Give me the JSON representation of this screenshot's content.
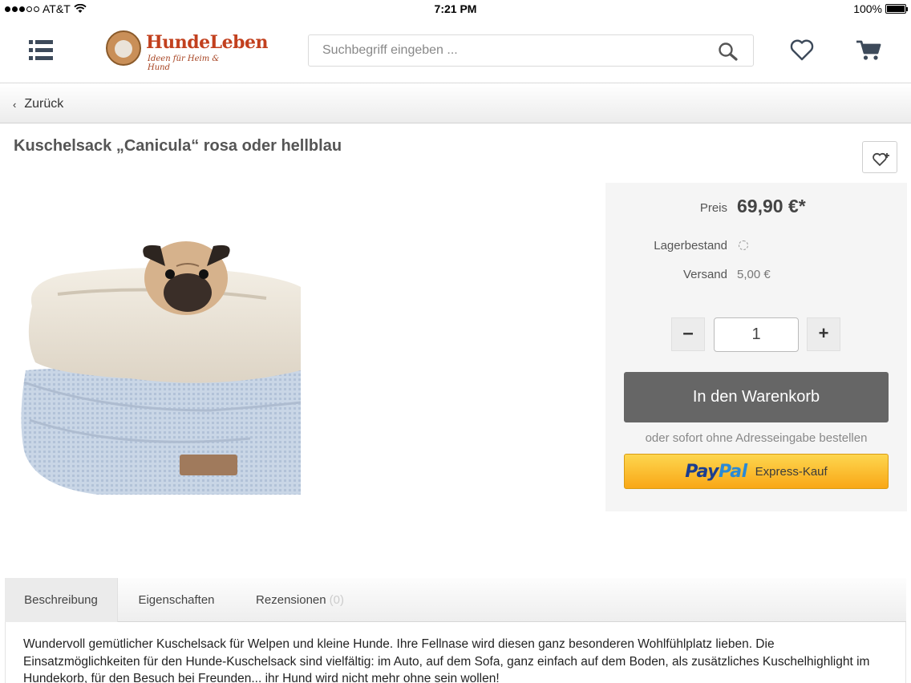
{
  "status_bar": {
    "carrier": "AT&T",
    "time": "7:21 PM",
    "battery": "100%"
  },
  "header": {
    "logo_name": "HundeLeben",
    "logo_tagline": "Ideen für Heim & Hund",
    "search_placeholder": "Suchbegriff eingeben ..."
  },
  "nav": {
    "back_label": "Zurück"
  },
  "product": {
    "title": "Kuschelsack „Canicula“ rosa oder hellblau"
  },
  "buybox": {
    "price_label": "Preis",
    "price_value": "69,90 €*",
    "stock_label": "Lagerbestand",
    "shipping_label": "Versand",
    "shipping_value": "5,00 €",
    "quantity": "1",
    "minus_label": "–",
    "plus_label": "+",
    "cart_button_label": "In den Warenkorb",
    "express_note": "oder sofort ohne Adresseingabe bestellen",
    "paypal_logo_a": "Pay",
    "paypal_logo_b": "Pal",
    "paypal_label": "Express-Kauf"
  },
  "tabs": [
    {
      "label": "Beschreibung",
      "active": true
    },
    {
      "label": "Eigenschaften"
    },
    {
      "label": "Rezensionen",
      "count": "(0)"
    }
  ],
  "description": "Wundervoll gemütlicher Kuschelsack für Welpen und kleine Hunde. Ihre Fellnase wird diesen ganz besonderen Wohlfühlplatz lieben. Die Einsatzmöglichkeiten für den Hunde-Kuschelsack sind vielfältig: im Auto, auf dem Sofa, ganz einfach auf dem Boden, als zusätzliches Kuschelhighlight im Hundekorb, für den Besuch bei Freunden... ihr Hund wird nicht mehr ohne sein wollen!",
  "colors": {
    "cart_button": "#666666",
    "paypal_yellow": "#f9b421",
    "logo_red": "#c2401e"
  }
}
